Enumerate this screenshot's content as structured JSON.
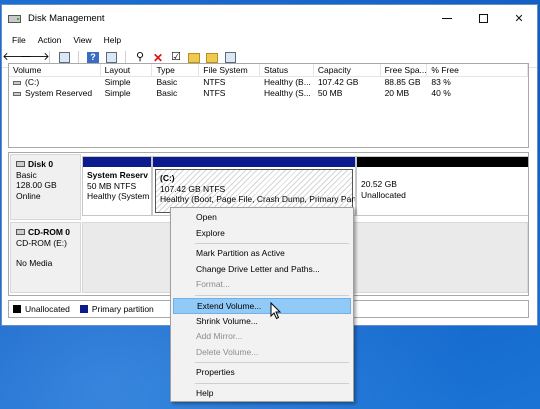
{
  "window": {
    "title": "Disk Management",
    "app_icon": "disk-management-icon"
  },
  "menu": [
    "File",
    "Action",
    "View",
    "Help"
  ],
  "toolbar_icons": [
    "back-arrow-icon",
    "forward-arrow-icon",
    "console-tree-icon",
    "help-icon",
    "properties-icon",
    "connect-icon",
    "delete-icon",
    "check-icon",
    "folder-up-icon",
    "folder-star-icon",
    "properties-sheet-icon"
  ],
  "volume_list": {
    "headers": [
      "Volume",
      "Layout",
      "Type",
      "File System",
      "Status",
      "Capacity",
      "Free Spa...",
      "% Free"
    ],
    "rows": [
      [
        "(C:)",
        "Simple",
        "Basic",
        "NTFS",
        "Healthy (B...",
        "107.42 GB",
        "88.85 GB",
        "83 %"
      ],
      [
        "System Reserved",
        "Simple",
        "Basic",
        "NTFS",
        "Healthy (S...",
        "50 MB",
        "20 MB",
        "40 %"
      ]
    ]
  },
  "disks": {
    "disk0": {
      "name": "Disk 0",
      "type": "Basic",
      "size": "128.00 GB",
      "status": "Online",
      "partitions": [
        {
          "name": "System Reserv",
          "size": "50 MB NTFS",
          "status": "Healthy (System"
        },
        {
          "name": "(C:)",
          "size": "107.42 GB NTFS",
          "status": "Healthy (Boot, Page File, Crash Dump, Primary Partiti"
        },
        {
          "name": "",
          "size": "20.52 GB",
          "status": "Unallocated"
        }
      ]
    },
    "cdrom0": {
      "name": "CD-ROM 0",
      "drive": "CD-ROM (E:)",
      "media": "No Media"
    }
  },
  "legend": [
    {
      "label": "Unallocated",
      "color": "#000000"
    },
    {
      "label": "Primary partition",
      "color": "#0b1a8c"
    }
  ],
  "context_menu": {
    "items": [
      {
        "label": "Open",
        "enabled": true
      },
      {
        "label": "Explore",
        "enabled": true
      },
      {
        "label": "Mark Partition as Active",
        "enabled": true
      },
      {
        "label": "Change Drive Letter and Paths...",
        "enabled": true
      },
      {
        "label": "Format...",
        "enabled": false
      },
      {
        "label": "Extend Volume...",
        "enabled": true,
        "highlighted": true
      },
      {
        "label": "Shrink Volume...",
        "enabled": true
      },
      {
        "label": "Add Mirror...",
        "enabled": false
      },
      {
        "label": "Delete Volume...",
        "enabled": false
      },
      {
        "label": "Properties",
        "enabled": true
      },
      {
        "label": "Help",
        "enabled": true
      }
    ]
  }
}
